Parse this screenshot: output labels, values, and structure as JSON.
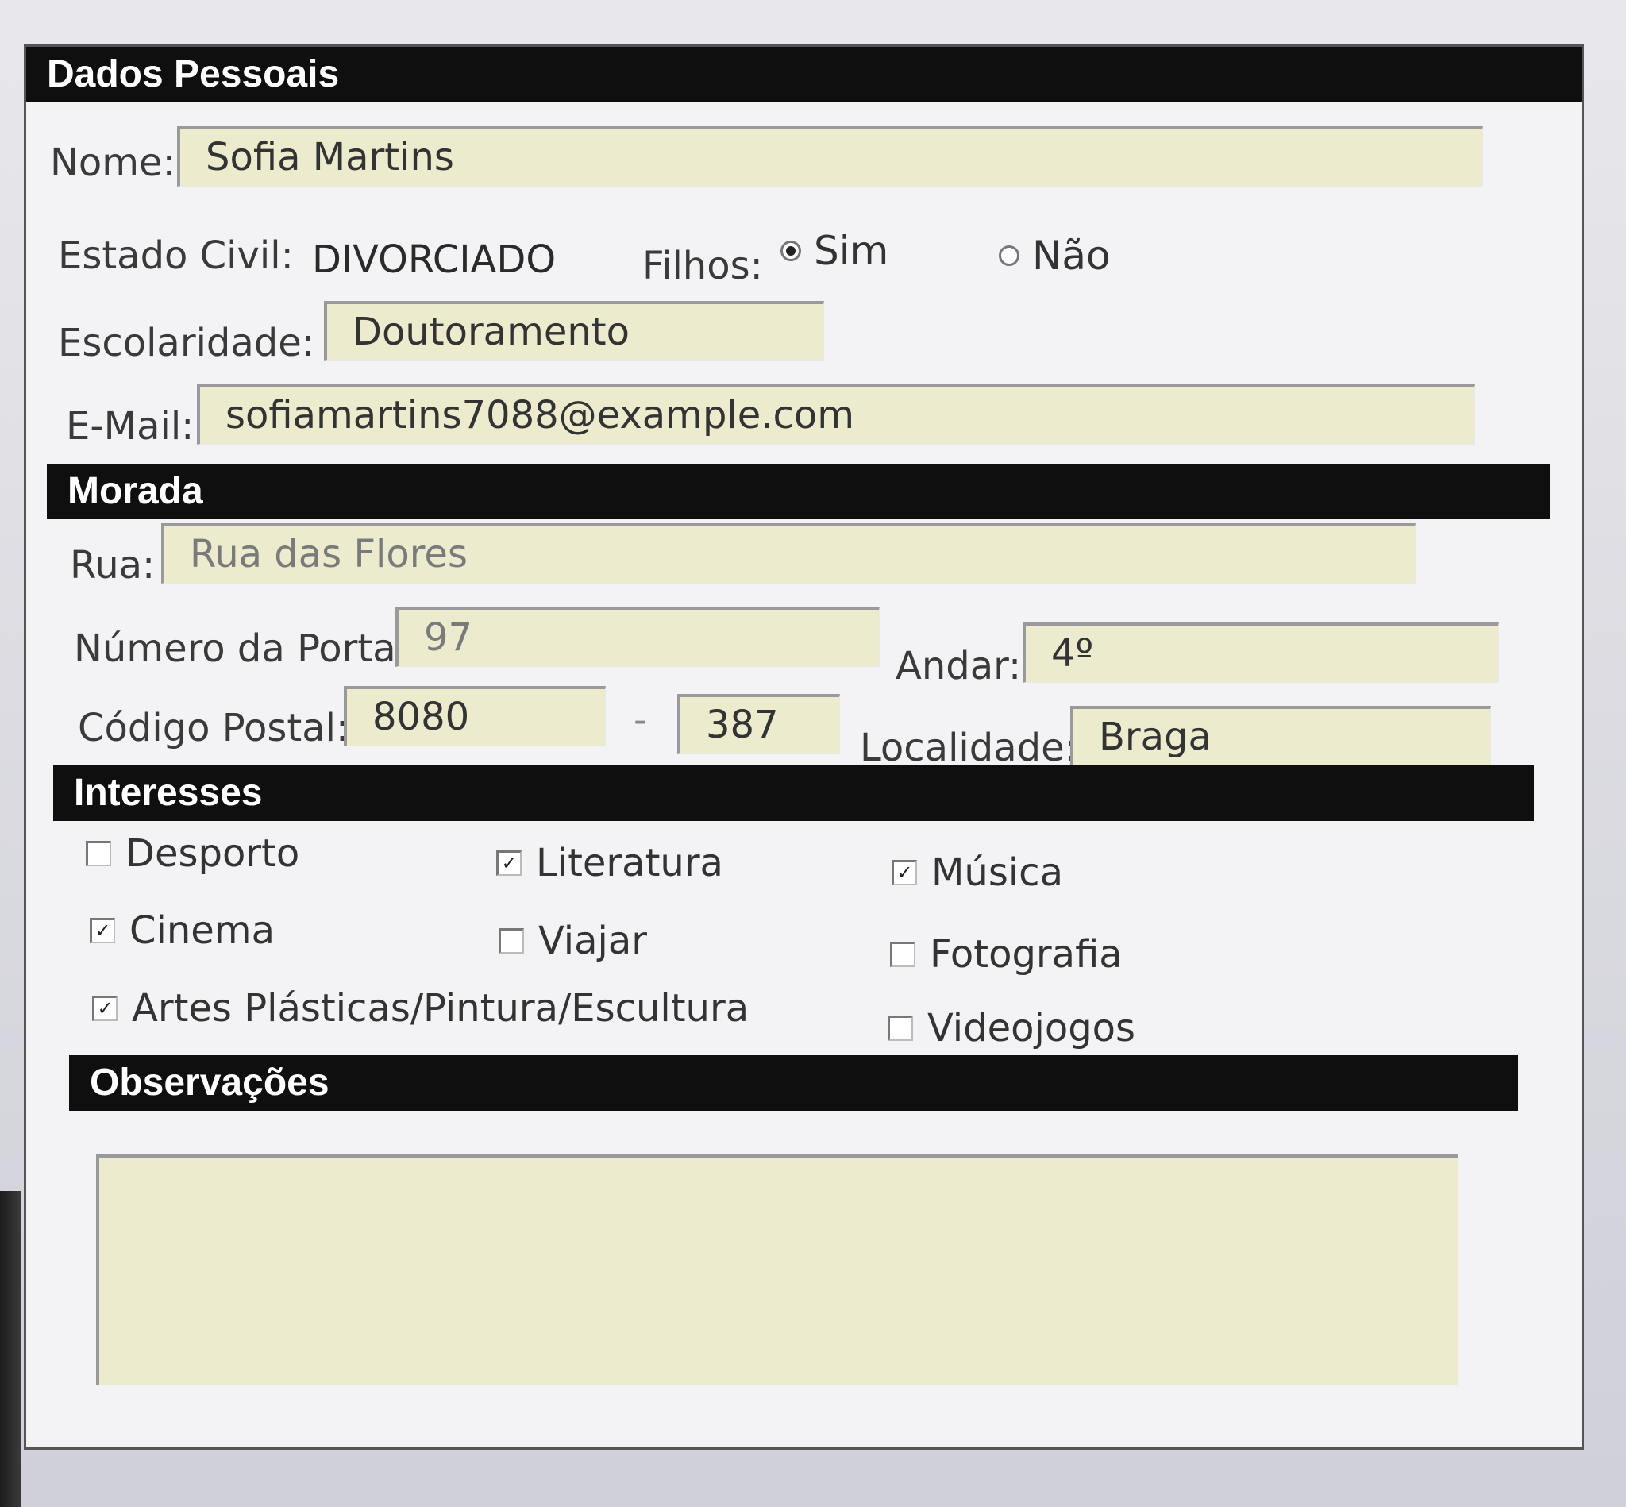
{
  "sections": {
    "personal": "Dados Pessoais",
    "address": "Morada",
    "interests": "Interesses",
    "notes": "Observações"
  },
  "personal": {
    "name_label": "Nome:",
    "name_value": "Sofia Martins",
    "civil_label": "Estado Civil:",
    "civil_value": "DIVORCIADO",
    "children_label": "Filhos:",
    "children_options": [
      "Sim",
      "Não"
    ],
    "children_selected": "Sim",
    "education_label": "Escolaridade:",
    "education_value": "Doutoramento",
    "email_label": "E-Mail:",
    "email_value": "sofiamartins7088@example.com"
  },
  "address": {
    "street_label": "Rua:",
    "street_value": "Rua das Flores",
    "door_label": "Número da Porta:",
    "door_value": "97",
    "floor_label": "Andar:",
    "floor_value": "4º",
    "postal_label": "Código Postal:",
    "postal_part1": "8080",
    "postal_separator": "-",
    "postal_part2": "387",
    "locality_label": "Localidade:",
    "locality_value": "Braga"
  },
  "interests": {
    "items": [
      {
        "label": "Desporto",
        "checked": false
      },
      {
        "label": "Literatura",
        "checked": true
      },
      {
        "label": "Música",
        "checked": true
      },
      {
        "label": "Cinema",
        "checked": true
      },
      {
        "label": "Viajar",
        "checked": false
      },
      {
        "label": "Fotografia",
        "checked": false
      },
      {
        "label": "Artes Plásticas/Pintura/Escultura",
        "checked": true
      },
      {
        "label": "Videojogos",
        "checked": false
      }
    ],
    "check_mark": "✓"
  },
  "notes": {
    "value": ""
  }
}
